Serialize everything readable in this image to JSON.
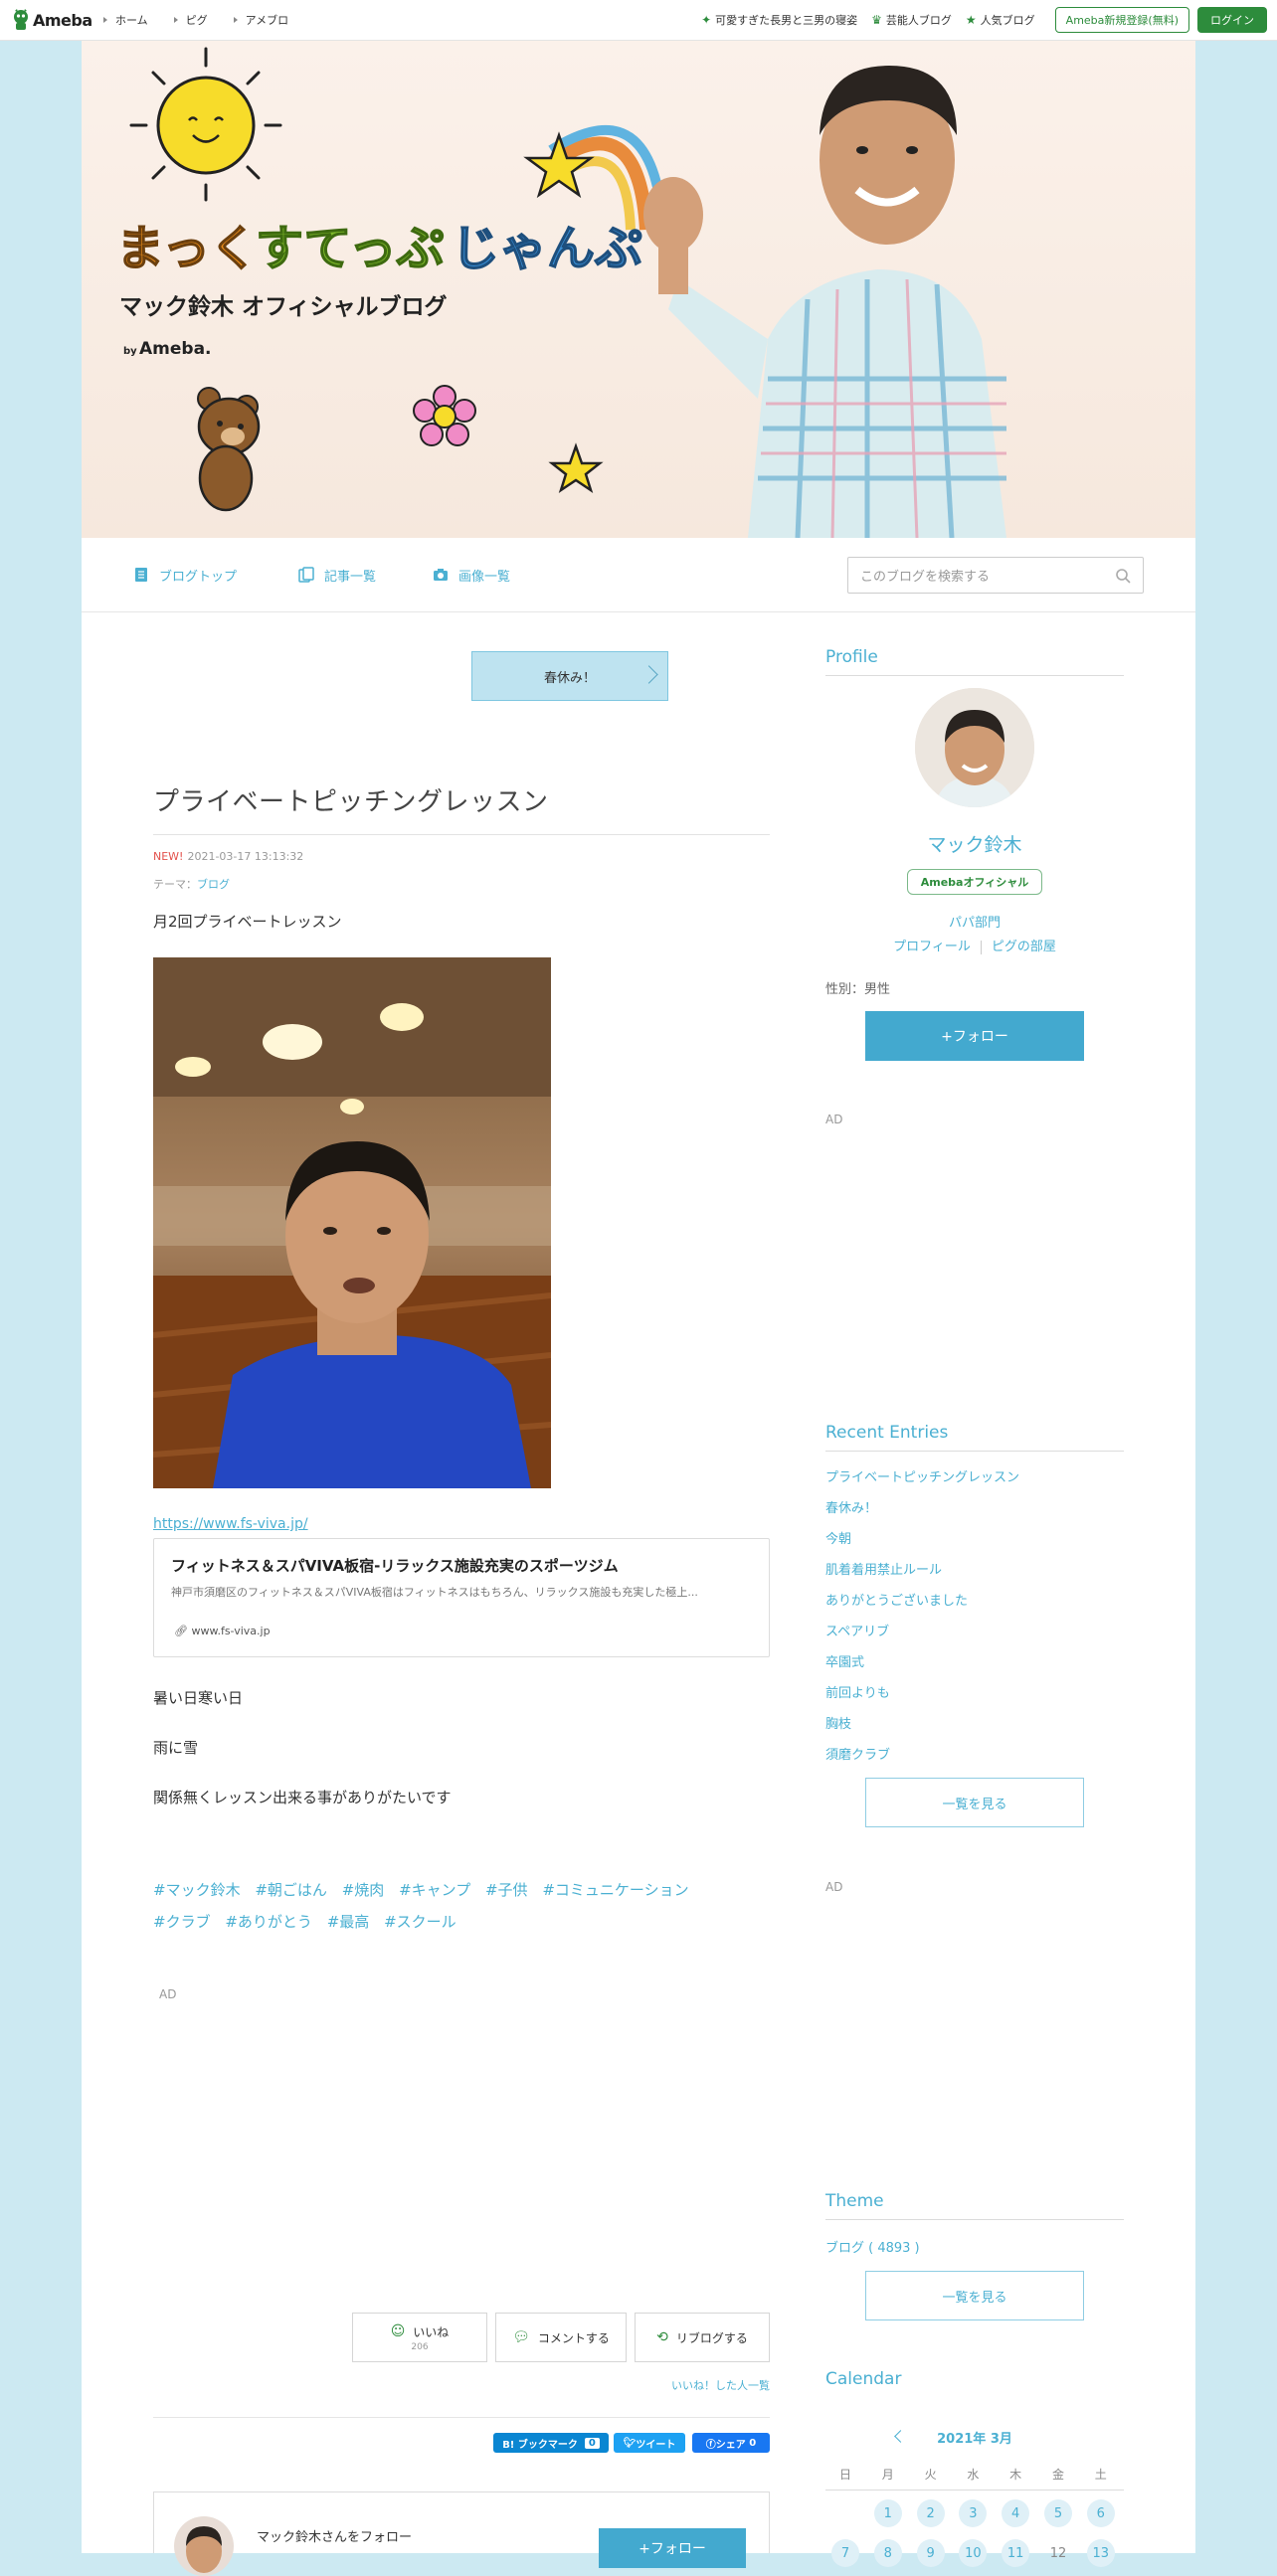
{
  "global_header": {
    "logo": "Ameba",
    "nav": [
      "ホーム",
      "ピグ",
      "アメブロ"
    ],
    "right_links": [
      {
        "label": "可愛すぎた長男と三男の寝姿",
        "icon": "sparkle-icon"
      },
      {
        "label": "芸能人ブログ",
        "icon": "crown-icon"
      },
      {
        "label": "人気ブログ",
        "icon": "star-icon"
      }
    ],
    "register_button": "Ameba新規登録(無料)",
    "login_button": "ログイン"
  },
  "banner": {
    "title_part1": "まっく",
    "title_part2": "すてっぷ",
    "title_part3": "じゃんぷ",
    "subtitle": "マック鈴木 オフィシャルブログ",
    "by": "by",
    "by_brand": "Ameba."
  },
  "blog_nav": {
    "items": [
      "ブログトップ",
      "記事一覧",
      "画像一覧"
    ],
    "search_placeholder": "このブログを検索する"
  },
  "article": {
    "prev_entry": "春休み！",
    "title": "プライベートピッチングレッスン",
    "new_badge": "NEW!",
    "datetime": "2021-03-17 13:13:32",
    "theme_prefix": "テーマ：",
    "theme": "ブログ",
    "paragraph1": "月2回プライベートレッスン",
    "link_url": "https://www.fs-viva.jp/",
    "card": {
      "title": "フィットネス＆スパVIVA板宿-リラックス施設充実のスポーツジム",
      "description": "神戸市須磨区のフィットネス＆スパVIVA板宿はフィットネスはもちろん、リラックス施設も充実した極上...",
      "domain": "www.fs-viva.jp"
    },
    "paragraph2": "暑い日寒い日",
    "paragraph3": "雨に雪",
    "paragraph4": "関係無くレッスン出来る事がありがたいです",
    "hashtags": [
      "#マック鈴木",
      "#朝ごはん",
      "#焼肉",
      "#キャンプ",
      "#子供",
      "#コミュニケーション",
      "#クラブ",
      "#ありがとう",
      "#最高",
      "#スクール"
    ],
    "ad_label": "AD",
    "actions": {
      "like_label": "いいね",
      "like_count": "206",
      "comment_label": "コメントする",
      "reblog_label": "リブログする"
    },
    "likes_list": "いいね！した人一覧",
    "share": {
      "hatena": "B! ブックマーク",
      "hatena_count": "0",
      "tweet": "ツイート",
      "facebook": "シェア",
      "facebook_count": "0"
    },
    "follow_box": {
      "text": "マック鈴木さんをフォロー",
      "button": "+フォロー"
    }
  },
  "sidebar": {
    "profile": {
      "heading": "Profile",
      "name": "マック鈴木",
      "badge": "Amebaオフィシャル",
      "category": "パパ部門",
      "links": [
        "プロフィール",
        "ピグの部屋"
      ],
      "sex": "性別：男性",
      "follow_button": "+フォロー"
    },
    "ad_label": "AD",
    "recent": {
      "heading": "Recent Entries",
      "items": [
        "プライベートピッチングレッスン",
        "春休み！",
        "今朝",
        "肌着着用禁止ルール",
        "ありがとうございました",
        "スペアリブ",
        "卒園式",
        "前回よりも",
        "胸枝",
        "須磨クラブ"
      ],
      "more": "一覧を見る"
    },
    "theme": {
      "heading": "Theme",
      "item": "ブログ ( 4893 )",
      "more": "一覧を見る"
    },
    "calendar": {
      "heading": "Calendar",
      "month": "2021年 3月",
      "dow": [
        "日",
        "月",
        "火",
        "水",
        "木",
        "金",
        "土"
      ],
      "row1": [
        "",
        "1",
        "2",
        "3",
        "4",
        "5",
        "6"
      ],
      "row2": [
        "7",
        "8",
        "9",
        "10",
        "11",
        "12",
        "13"
      ],
      "plain_days": [
        "12"
      ]
    }
  },
  "colors": {
    "accent": "#4bb0d2",
    "ameba_green": "#2d8c3c",
    "page_bg": "#cce9f2",
    "new_red": "#e3514c"
  }
}
